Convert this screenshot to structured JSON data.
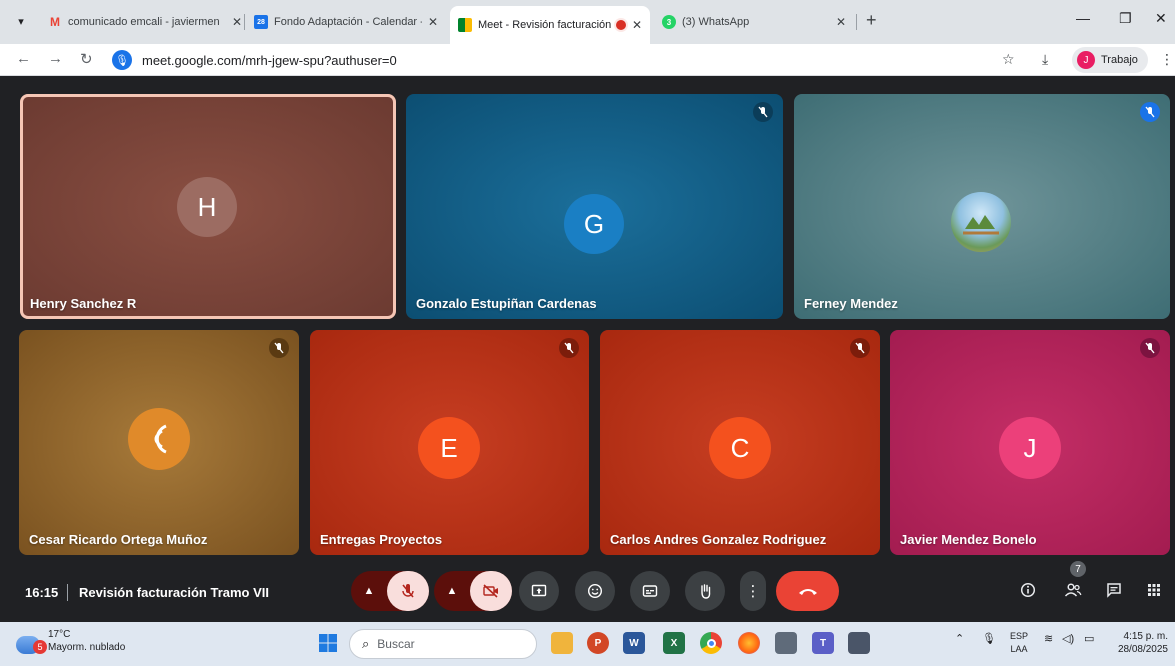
{
  "browser": {
    "tabs": [
      {
        "title": "comunicado emcali - javiermen",
        "favicon": "gmail-icon"
      },
      {
        "title": "Fondo Adaptación - Calendar -",
        "favicon": "calendar-icon",
        "favicon_text": "28"
      },
      {
        "title": "Meet - Revisión facturación",
        "favicon": "meet-icon",
        "active": true
      },
      {
        "title": "(3) WhatsApp",
        "favicon": "whatsapp-icon"
      }
    ],
    "url": "meet.google.com/mrh-jgew-spu?authuser=0",
    "profile": {
      "initial": "J",
      "label": "Trabajo"
    }
  },
  "meet": {
    "participants": [
      {
        "name": "Henry Sanchez R",
        "initial": "H",
        "bg": "#7d4538",
        "avatar_color": "#9c6c62",
        "muted": false,
        "speaking": true
      },
      {
        "name": "Gonzalo Estupiñan Cardenas",
        "initial": "G",
        "bg": "#0f5d86",
        "avatar_color": "#1a7fc4",
        "muted": true
      },
      {
        "name": "Ferney Mendez",
        "initial": "",
        "bg": "#4f7f86",
        "avatar_color": "#6fa2c9",
        "muted": true,
        "photo": true
      },
      {
        "name": "Cesar Ricardo Ortega Muñoz",
        "initial": "",
        "bg": "#9a6a2a",
        "avatar_color": "#e08a2a",
        "muted": true,
        "logo": true
      },
      {
        "name": "Entregas Proyectos",
        "initial": "E",
        "bg": "#b8321a",
        "avatar_color": "#f4511e",
        "muted": true
      },
      {
        "name": "Carlos Andres Gonzalez Rodriguez",
        "initial": "C",
        "bg": "#b8321a",
        "avatar_color": "#f4511e",
        "muted": true
      },
      {
        "name": "Javier Mendez Bonelo",
        "initial": "J",
        "bg": "#b7245c",
        "avatar_color": "#ec407a",
        "muted": true
      }
    ],
    "time": "16:15",
    "meeting_title": "Revisión facturación Tramo VII",
    "people_count": "7"
  },
  "taskbar": {
    "weather_badge": "5",
    "temperature": "17°C",
    "weather_desc": "Mayorm. nublado",
    "search_placeholder": "Buscar",
    "lang_top": "ESP",
    "lang_bottom": "LAA",
    "time": "4:15 p. m.",
    "date": "28/08/2025"
  }
}
